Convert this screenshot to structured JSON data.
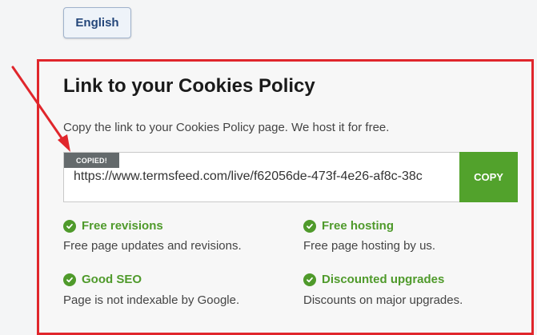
{
  "language_button": {
    "label": "English"
  },
  "panel": {
    "title": "Link to your Cookies Policy",
    "description": "Copy the link to your Cookies Policy page. We host it for free.",
    "link_value": "https://www.termsfeed.com/live/f62056de-473f-4e26-af8c-38c",
    "copied_badge": "COPIED!",
    "copy_button": "COPY"
  },
  "features": [
    {
      "title": "Free revisions",
      "desc": "Free page updates and revisions."
    },
    {
      "title": "Free hosting",
      "desc": "Free page hosting by us."
    },
    {
      "title": "Good SEO",
      "desc": "Page is not indexable by Google."
    },
    {
      "title": "Discounted upgrades",
      "desc": "Discounts on major upgrades."
    }
  ],
  "colors": {
    "accent_green": "#4f9a2b",
    "highlight_red": "#e0262c",
    "button_green": "#52a22c"
  },
  "icons": {
    "feature": "check-circle-icon",
    "annotation": "red-arrow-icon"
  }
}
